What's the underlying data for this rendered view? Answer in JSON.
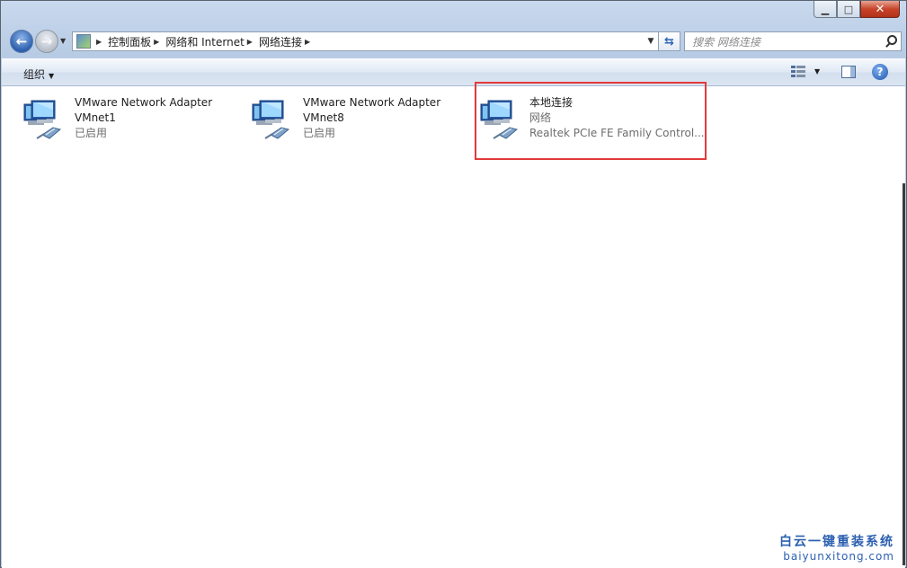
{
  "window": {
    "caption_buttons": {
      "minimize": "▁",
      "maximize": "□",
      "close": "✕"
    }
  },
  "nav": {
    "breadcrumbs": [
      "控制面板",
      "网络和 Internet",
      "网络连接"
    ],
    "search_placeholder": "搜索 网络连接",
    "refresh_glyph": "⇆"
  },
  "toolbar": {
    "organize_label": "组织",
    "help_label": "?"
  },
  "items": [
    {
      "name": "VMware Network Adapter",
      "line2": "VMnet1",
      "line3": "已启用",
      "icon": "network-adapter-icon"
    },
    {
      "name": "VMware Network Adapter",
      "line2": "VMnet8",
      "line3": "已启用",
      "icon": "network-adapter-icon"
    },
    {
      "name": "本地连接",
      "line2": "网络",
      "line3": "Realtek PCIe FE Family Control...",
      "icon": "network-adapter-icon",
      "highlighted": true
    }
  ],
  "watermark": {
    "line1": "白云一键重装系统",
    "line2": "baiyunxitong.com"
  },
  "colors": {
    "highlight": "#e13a3a",
    "accent": "#2d5fae"
  }
}
